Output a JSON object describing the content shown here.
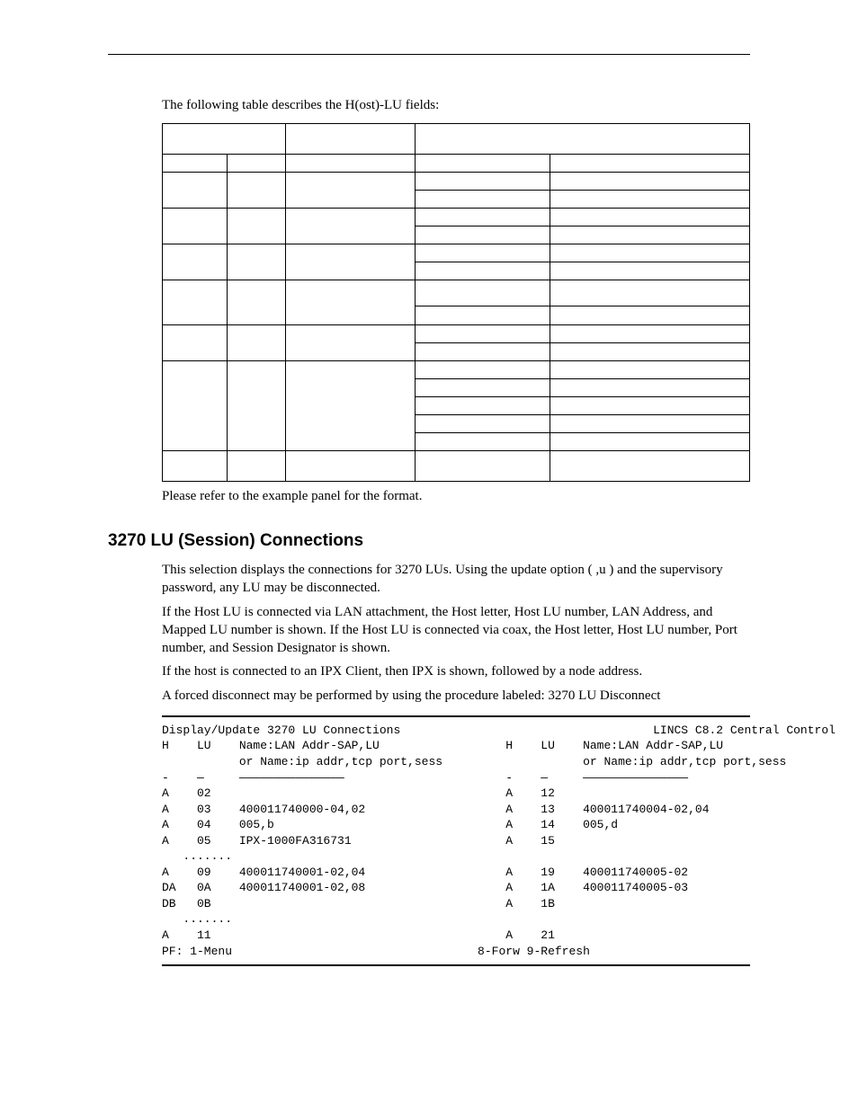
{
  "intro": "The following table describes the H(ost)-LU fields:",
  "afterTable": "Please refer to the example panel for the format.",
  "sectionTitle": "3270 LU (Session) Connections",
  "paragraphs": [
    "This selection displays the connections for 3270 LUs. Using the update option ( ,u ) and the supervisory password, any LU may be disconnected.",
    "If the Host LU is connected via LAN attachment, the Host letter, Host LU number, LAN Address, and Mapped LU number is shown. If the Host LU is connected via coax, the Host letter, Host LU number, Port number, and Session Designator is shown.",
    "If the host is connected to an IPX Client, then IPX is shown, followed by a node address.",
    "A forced disconnect may be performed by using the procedure labeled: 3270 LU Disconnect"
  ],
  "terminal": {
    "titleLeft": "Display/Update 3270 LU Connections",
    "titleRight": "LINCS C8.2 Central Control",
    "header1": {
      "h": "H",
      "lu": "LU",
      "name1": "Name:LAN Addr-SAP,LU",
      "name2": "or Name:ip addr,tcp port,sess"
    },
    "dashRow": {
      "h": "-",
      "lu": "—",
      "name": "———————————————"
    },
    "rows": [
      {
        "l": {
          "h": "A",
          "lu": "02",
          "n": ""
        },
        "r": {
          "h": "A",
          "lu": "12",
          "n": ""
        }
      },
      {
        "l": {
          "h": "A",
          "lu": "03",
          "n": "400011740000-04,02"
        },
        "r": {
          "h": "A",
          "lu": "13",
          "n": "400011740004-02,04"
        }
      },
      {
        "l": {
          "h": "A",
          "lu": "04",
          "n": "005,b"
        },
        "r": {
          "h": "A",
          "lu": "14",
          "n": "005,d"
        }
      },
      {
        "l": {
          "h": "A",
          "lu": "05",
          "n": "IPX-1000FA316731"
        },
        "r": {
          "h": "A",
          "lu": "15",
          "n": ""
        }
      }
    ],
    "dots": "   .......",
    "rows2": [
      {
        "l": {
          "h": "A",
          "lu": "09",
          "n": "400011740001-02,04"
        },
        "r": {
          "h": "A",
          "lu": "19",
          "n": "400011740005-02"
        }
      },
      {
        "l": {
          "h": "DA",
          "lu": "0A",
          "n": "400011740001-02,08"
        },
        "r": {
          "h": "A",
          "lu": "1A",
          "n": "400011740005-03"
        }
      },
      {
        "l": {
          "h": "DB",
          "lu": "0B",
          "n": ""
        },
        "r": {
          "h": "A",
          "lu": "1B",
          "n": ""
        }
      }
    ],
    "rows3": [
      {
        "l": {
          "h": "A",
          "lu": "11",
          "n": ""
        },
        "r": {
          "h": "A",
          "lu": "21",
          "n": ""
        }
      }
    ],
    "footerLeft": "PF: 1-Menu",
    "footerRight": "8-Forw 9-Refresh"
  }
}
